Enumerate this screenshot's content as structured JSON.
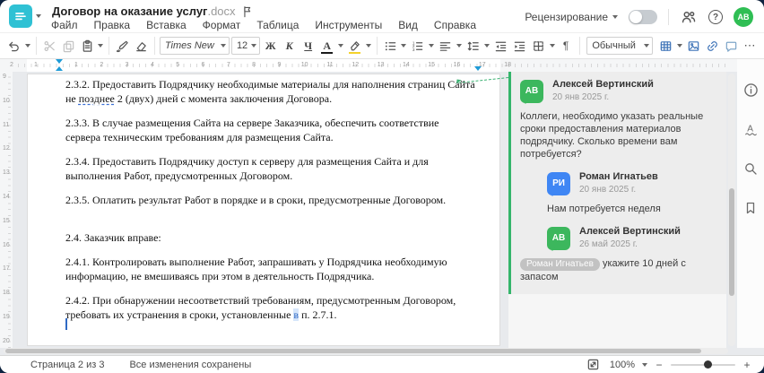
{
  "window": {
    "title": "Договор на оказание услуг",
    "ext": ".docx"
  },
  "menus": [
    "Файл",
    "Правка",
    "Вставка",
    "Формат",
    "Таблица",
    "Инструменты",
    "Вид",
    "Справка"
  ],
  "header": {
    "review": "Рецензирование",
    "avatar": "АВ"
  },
  "toolbar": {
    "font": "Times New ...",
    "size": "12",
    "bold": "Ж",
    "italic": "К",
    "underline": "Ч",
    "color_letter": "А",
    "style": "Обычный",
    "pilcrow": "¶",
    "more": "⋯"
  },
  "ruler": {
    "pre": [
      "2",
      "1"
    ],
    "nums": [
      "1",
      "2",
      "3",
      "4",
      "5",
      "6",
      "7",
      "8",
      "9",
      "10",
      "11",
      "12",
      "13",
      "14",
      "15",
      "16",
      "17",
      "18"
    ],
    "vnums": [
      "9",
      "10",
      "11",
      "12",
      "13",
      "14",
      "15",
      "16",
      "17",
      "18",
      "19",
      "20"
    ]
  },
  "doc": {
    "paragraphs": [
      {
        "runs": [
          {
            "t": "2.3.2. Предоставить Подрядчику необходимые материалы для наполнения страниц Сайта не "
          },
          {
            "t": "позднее",
            "s": "ins"
          },
          {
            "t": " 2 (двух) дней с момента заключения Договора."
          }
        ]
      },
      {
        "runs": [
          {
            "t": "2.3.3. В случае размещения Сайта на сервере Заказчика, обеспечить соответствие сервера техническим требованиям для размещения Сайта."
          }
        ]
      },
      {
        "runs": [
          {
            "t": "2.3.4. Предоставить Подрядчику доступ к серверу для размещения Сайта и для выполнения Работ, предусмотренных Договором."
          }
        ]
      },
      {
        "runs": [
          {
            "t": "2.3.5. Оплатить результат Работ в порядке и в сроки, предусмотренные Договором."
          }
        ]
      },
      {
        "cls": "gap-top",
        "runs": [
          {
            "t": "2.4. Заказчик вправе:"
          }
        ]
      },
      {
        "runs": [
          {
            "t": "2.4.1. Контролировать выполнение Работ, запрашивать у Подрядчика необходимую информацию, не вмешиваясь при этом в деятельность Подрядчика."
          }
        ]
      },
      {
        "runs": [
          {
            "t": "2.4.2. При обнаружении несоответствий требованиям, предусмотренным Договором, требовать их устранения в сроки, установленные "
          },
          {
            "t": "в",
            "s": "hl"
          },
          {
            "t": " п. 2.7.1."
          }
        ]
      }
    ]
  },
  "comments": {
    "root": {
      "initials": "АВ",
      "name": "Алексей Вертинский",
      "date": "20 янв 2025 г.",
      "text": "Коллеги, необходимо указать реальные сроки предоставления материалов подрядчику. Сколько времени вам потребуется?"
    },
    "reply1": {
      "initials": "РИ",
      "name": "Роман Игнатьев",
      "date": "20 янв 2025 г.",
      "text": "Нам потребуется неделя"
    },
    "reply2": {
      "initials": "АВ",
      "name": "Алексей Вертинский",
      "date": "26 май 2025 г.",
      "mention": "Роман Игнатьев",
      "text": " укажите 10 дней с запасом"
    }
  },
  "status": {
    "page": "Страница 2 из 3",
    "saved": "Все изменения сохранены",
    "zoom": "100%",
    "minus": "−",
    "plus": "+",
    "help": "?"
  },
  "colors": {
    "teal": "#2fc1d4",
    "green": "#3cb75d",
    "blue": "#3f86f4",
    "accent_blue": "#3f74b8",
    "thread_border": "#34b56b",
    "insert_underline": "#3b6fd4",
    "connector_green": "#3bb273"
  }
}
